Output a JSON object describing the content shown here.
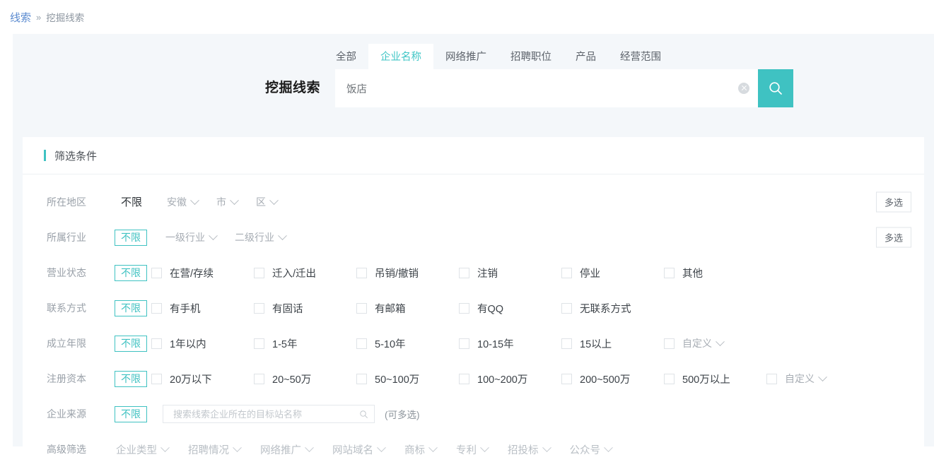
{
  "breadcrumb": {
    "root": "线索",
    "separator": "»",
    "current": "挖掘线索"
  },
  "search": {
    "title": "挖掘线索",
    "value": "饭店",
    "placeholder": "",
    "tabs": [
      {
        "label": "全部",
        "active": false
      },
      {
        "label": "企业名称",
        "active": true
      },
      {
        "label": "网络推广",
        "active": false
      },
      {
        "label": "招聘职位",
        "active": false
      },
      {
        "label": "产品",
        "active": false
      },
      {
        "label": "经营范围",
        "active": false
      }
    ],
    "clear_icon": "close-circle-icon",
    "search_icon": "search-icon",
    "accent_color": "#3fc2c2"
  },
  "filter": {
    "heading": "筛选条件",
    "multi_select_label": "多选",
    "unlimited_label": "不限",
    "region": {
      "label": "所在地区",
      "unlimited": "不限",
      "dropdowns": [
        "安徽",
        "市",
        "区"
      ]
    },
    "industry": {
      "label": "所属行业",
      "unlimited": "不限",
      "dropdowns": [
        "一级行业",
        "二级行业"
      ]
    },
    "status": {
      "label": "营业状态",
      "unlimited": "不限",
      "options": [
        "在营/存续",
        "迁入/迁出",
        "吊销/撤销",
        "注销",
        "停业",
        "其他"
      ]
    },
    "contact": {
      "label": "联系方式",
      "unlimited": "不限",
      "options": [
        "有手机",
        "有固话",
        "有邮箱",
        "有QQ",
        "无联系方式"
      ]
    },
    "years": {
      "label": "成立年限",
      "unlimited": "不限",
      "options": [
        "1年以内",
        "1-5年",
        "5-10年",
        "10-15年",
        "15以上"
      ],
      "custom": "自定义"
    },
    "capital": {
      "label": "注册资本",
      "unlimited": "不限",
      "options": [
        "20万以下",
        "20~50万",
        "50~100万",
        "100~200万",
        "200~500万",
        "500万以上"
      ],
      "custom": "自定义"
    },
    "source": {
      "label": "企业来源",
      "unlimited": "不限",
      "placeholder": "搜索线索企业所在的目标站名称",
      "value": "",
      "note": "(可多选)",
      "search_icon": "search-icon"
    },
    "advanced": {
      "label": "高级筛选",
      "items": [
        "企业类型",
        "招聘情况",
        "网络推广",
        "网站域名",
        "商标",
        "专利",
        "招投标",
        "公众号"
      ]
    }
  }
}
